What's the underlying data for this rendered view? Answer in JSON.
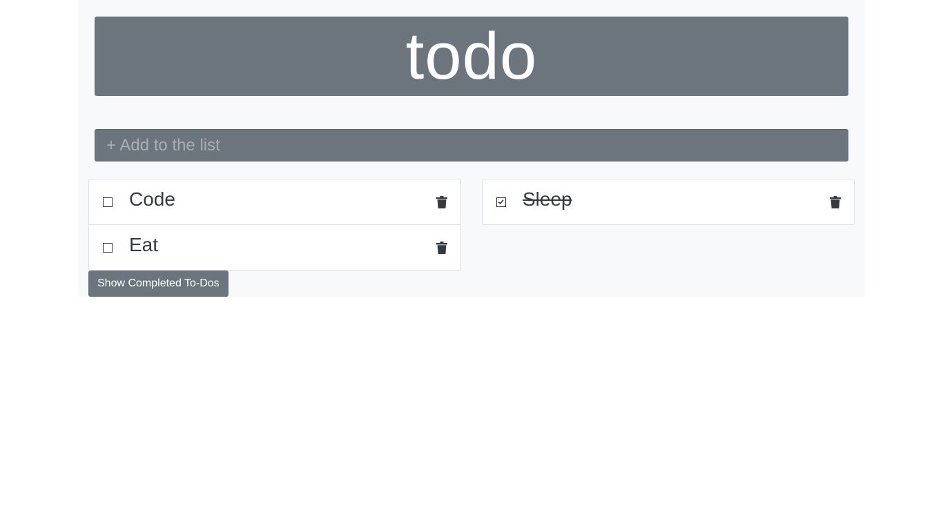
{
  "header": {
    "title": "todo"
  },
  "add": {
    "placeholder": "+ Add to the list"
  },
  "lists": {
    "active": [
      {
        "label": "Code",
        "checked": false
      },
      {
        "label": "Eat",
        "checked": false
      }
    ],
    "completed": [
      {
        "label": "Sleep",
        "checked": true
      }
    ]
  },
  "show_completed_button": {
    "label": "Show Completed To-Dos"
  },
  "colors": {
    "accent": "#6c757d",
    "background": "#f8f9fa",
    "text": "#343a40"
  },
  "icons": {
    "delete": "trash-icon",
    "unchecked": "square-icon",
    "checked": "checked-square-icon"
  }
}
